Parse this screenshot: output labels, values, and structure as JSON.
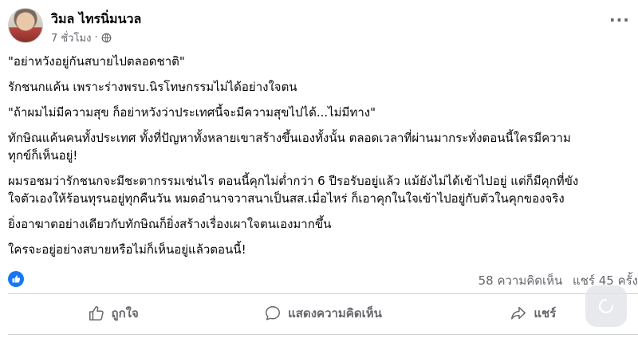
{
  "post": {
    "author": "วิมล ไทรนิ่มนวล",
    "time": "7 ชั่วโมง",
    "separator": "·",
    "paragraphs": [
      "\"อย่าหวังอยู่กันสบายไปตลอดชาติ\"",
      "รักชนกแค้น เพราะร่างพรบ.นิรโทษกรรมไม่ได้อย่างใจตน",
      "\"ถ้าผมไม่มีความสุข ก็อย่าหวังว่าประเทศนี้จะมีความสุขไปได้...ไม่มีทาง\"",
      "ทักษิณแค้นคนทั้งประเทศ ทั้งที่ปัญหาทั้งหลายเขาสร้างขึ้นเองทั้งนั้น ตลอดเวลาที่ผ่านมากระทั่งตอนนี้ใครมีความ\nทุกข์ก็เห็นอยู่!",
      "ผมรอชมว่ารักชนกจะมีชะตากรรมเช่นไร ตอนนี้คุกไม่ต่ำกว่า 6 ปีรอรับอยู่แล้ว แม้ยังไม่ได้เข้าไปอยู่ แต่ก็มีคุกที่ขัง\nใจตัวเองให้ร้อนทุรนอยู่ทุกคืนวัน หมดอำนาจวาสนาเป็นสส.เมื่อไหร่ ก็เอาคุกในใจเข้าไปอยู่กับตัวในคุกของจริง",
      "ยิ่งอาฆาตอย่างเดียวกับทักษิณก็ยิ่งสร้างเรื่องเผาใจตนเองมากขึ้น",
      "ใครจะอยู่อย่างสบายหรือไม่ก็เห็นอยู่แล้วตอนนี้!"
    ]
  },
  "stats": {
    "comments": "58 ความคิดเห็น",
    "shares": "แชร์ 45 ครั้ง"
  },
  "actions": {
    "like": "ถูกใจ",
    "comment": "แสดงความคิดเห็น",
    "share": "แชร์"
  },
  "icons": {
    "more": "more-options-icon",
    "audience": "globe-icon",
    "reaction": "like-reaction-icon",
    "like": "thumbs-up-icon",
    "comment": "comment-bubble-icon",
    "share": "share-arrow-icon",
    "floating": "loading-spinner-icon"
  },
  "colors": {
    "accent": "#1877f2",
    "secondary_text": "#65676b",
    "divider": "#ced0d4"
  }
}
